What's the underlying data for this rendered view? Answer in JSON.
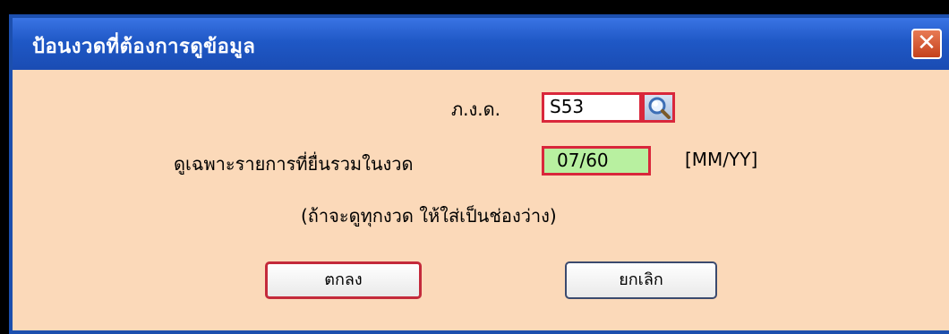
{
  "window": {
    "title": "ป้อนงวดที่ต้องการดูข้อมูล",
    "close_glyph": "✕"
  },
  "form": {
    "code_label": "ภ.ง.ด.",
    "code_value": "S53",
    "lookup_icon": "magnifier-icon",
    "period_label": "ดูเฉพาะรายการที่ยื่นรวมในงวด",
    "period_value": "07/60",
    "period_format": "[MM/YY]",
    "hint": "(ถ้าจะดูทุกงวด ให้ใส่เป็นช่องว่าง)"
  },
  "buttons": {
    "ok_label": "ตกลง",
    "cancel_label": "ยกเลิก"
  },
  "colors": {
    "title_bar": "#1f58c6",
    "body_bg": "#fbd9b9",
    "focus_border": "#d9273b",
    "period_bg": "#b8f0a0"
  }
}
